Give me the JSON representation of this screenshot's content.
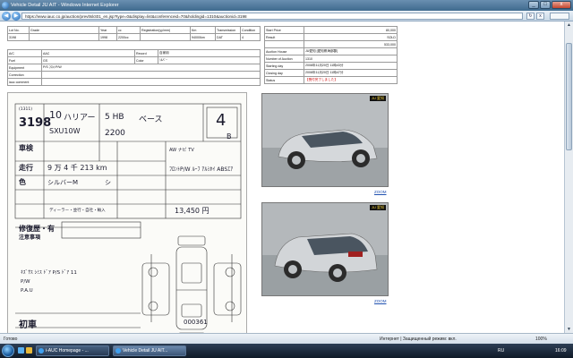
{
  "window": {
    "title": "Vehicle Detail JU AIT - Windows Internet Explorer",
    "minimize": "_",
    "maximize": "□",
    "close": "x"
  },
  "address": {
    "url": "https://www.iauc.co.jp/auction/prevltslct01_en.jsp?type=0&display=list&conferenceid=70&holdingid=1310&auctionid=3198",
    "back": "◀",
    "forward": "▶",
    "refresh": "↻",
    "stop": "x"
  },
  "details": {
    "header_labels": [
      "Lot No.",
      "Grade",
      "Year",
      "cc",
      "Registration(yy/mm)",
      "Km",
      "Transmission",
      "Condition"
    ],
    "header_values": [
      "3198",
      "",
      "1998",
      "2200cc",
      "",
      "94000km",
      "DAT",
      "4"
    ],
    "rows2": [
      {
        "label": "A/C",
        "value": "AAC",
        "label2": "Record",
        "value2": "自家用"
      },
      {
        "label": "Fuel",
        "value": "GS",
        "label2": "Color",
        "value2": "ｼﾙﾊﾞｰ"
      },
      {
        "label": "Equipment",
        "value": "P/S ﾌﾛﾝﾄP/W",
        "label2": "",
        "value2": ""
      },
      {
        "label": "Correction",
        "value": "",
        "label2": "",
        "value2": ""
      },
      {
        "label": "iauc comment",
        "value": "",
        "label2": "",
        "value2": ""
      }
    ]
  },
  "auction": {
    "rows": [
      {
        "label": "Start Price",
        "value": "80,000"
      },
      {
        "label": "Result",
        "value": "SOLD"
      },
      {
        "label": "",
        "value": "533,000"
      },
      {
        "label": "Auction House",
        "value": "JU愛知 [愛知県海部郡]"
      },
      {
        "label": "Number of Auction",
        "value": "1310"
      },
      {
        "label": "Starting day",
        "value": "2008年11月20日 11時43分"
      },
      {
        "label": "Closing day",
        "value": "2008年11月20日 11時47分"
      },
      {
        "label": "Status",
        "value": "【受付完了しました】"
      }
    ],
    "status_color": "#cc0000"
  },
  "sheet": {
    "lot": "3198",
    "lot_small": "(1311)",
    "year": "10",
    "model": "ハリアー",
    "doors": "5 HB",
    "grade": "ベース",
    "chassis": "SXU10W",
    "cc": "2200",
    "score": "4",
    "interior": "B",
    "labels": [
      "車検",
      "走行",
      "色",
      "修復歴・有",
      "注意事項",
      "初車"
    ],
    "mileage": "9 万 4 千 213 km",
    "color": "シルバーM",
    "color_code": "シ",
    "options": "AW  ナビ  TV",
    "equipment": "ﾌﾛﾝﾄP/W ﾙｰﾌ ｱﾙﾐﾎｲ ABSｴｱ",
    "recycle": "13,450 円",
    "notes": "ｷｽﾞｻｽ ｼﾐｽ ﾄﾞｱ  P/S ﾄﾞｱ 11\nP/W\nP.A.U",
    "serial": "000361",
    "dealer": "ディーラー・並行・自社・輸入"
  },
  "photos": [
    {
      "badge": "JU 愛知",
      "zoom": "ZOOM"
    },
    {
      "badge": "JU 愛知",
      "zoom": "ZOOM"
    }
  ],
  "status_bar": {
    "text": "Готово",
    "zone": "Интернет | Защищенный режим: вкл.",
    "zoom": "100%"
  },
  "taskbar": {
    "tasks": [
      "i-AUC Homepage - ...",
      "Vehicle Detail JU AIT..."
    ],
    "lang": "RU",
    "clock": "16:09"
  },
  "colors": {
    "titlebar": "#3f6a8e",
    "link": "#1f50b0"
  }
}
